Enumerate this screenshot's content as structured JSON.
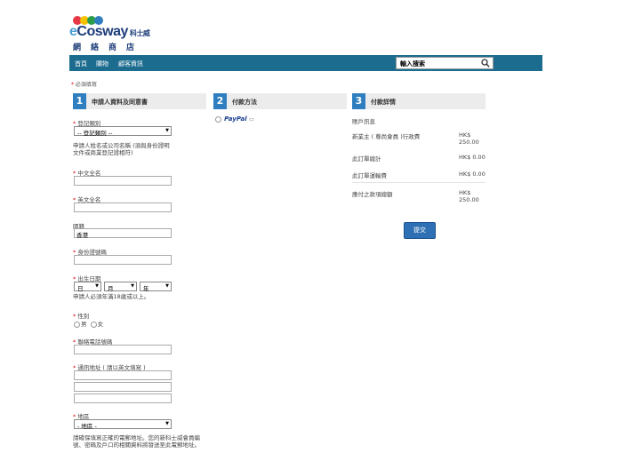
{
  "brand": {
    "logo_text_e": "e",
    "logo_text_rest": "Cosway",
    "logo_cn": "科士威",
    "logo_sub": "網絡商店",
    "dot_colors": [
      "#e63946",
      "#f6c200",
      "#2a9d4a",
      "#2f7fc0"
    ]
  },
  "nav": {
    "items": [
      "首頁",
      "購物",
      "顧客資訊"
    ],
    "search_placeholder": "輸入搜索"
  },
  "required_note": "必須填寫",
  "steps": [
    {
      "num": "1",
      "title": "申請人資料及同意書"
    },
    {
      "num": "2",
      "title": "付款方法"
    },
    {
      "num": "3",
      "title": "付款詳情"
    }
  ],
  "form": {
    "reg_type_label": "登記類別",
    "reg_type_value": "-- 登記類別 --",
    "name_note": "申請人姓名或公司名稱 (須與身份證明文件或商業登記證相符)",
    "cn_name_label": "中文全名",
    "en_name_label": "英文全名",
    "nationality_label": "國籍",
    "nationality_value": "香港",
    "id_label": "身份證號碼",
    "dob_label": "出生日期",
    "dob_day": "日",
    "dob_month": "月",
    "dob_year": "年",
    "age_note": "申請人必須年滿18歲或以上。",
    "gender_label": "性別",
    "gender_male": "男",
    "gender_female": "女",
    "phone_label": "聯絡電話號碼",
    "address_label": "通訊地址 ( 請以英文填寫 )",
    "district_label": "地區",
    "district_value": "- 地區 -",
    "email_note": "請確保填寫正確的電郵地址。您的新科士威會員編號、密碼及戶口的相關資料將發送至此電郵地址。"
  },
  "payment": {
    "method": "PayPal"
  },
  "summary": {
    "section": "賬戶訊息",
    "rows": [
      {
        "label": "新業主 ( 尊尚會員 )行政費",
        "amount": "HK$ 250.00"
      },
      {
        "label": "此訂單總計",
        "amount": "HK$ 0.00"
      },
      {
        "label": "此訂單運輸費",
        "amount": "HK$ 0.00"
      },
      {
        "label": "應付之款項總額",
        "amount": "HK$ 250.00"
      }
    ],
    "submit_label": "提交"
  }
}
